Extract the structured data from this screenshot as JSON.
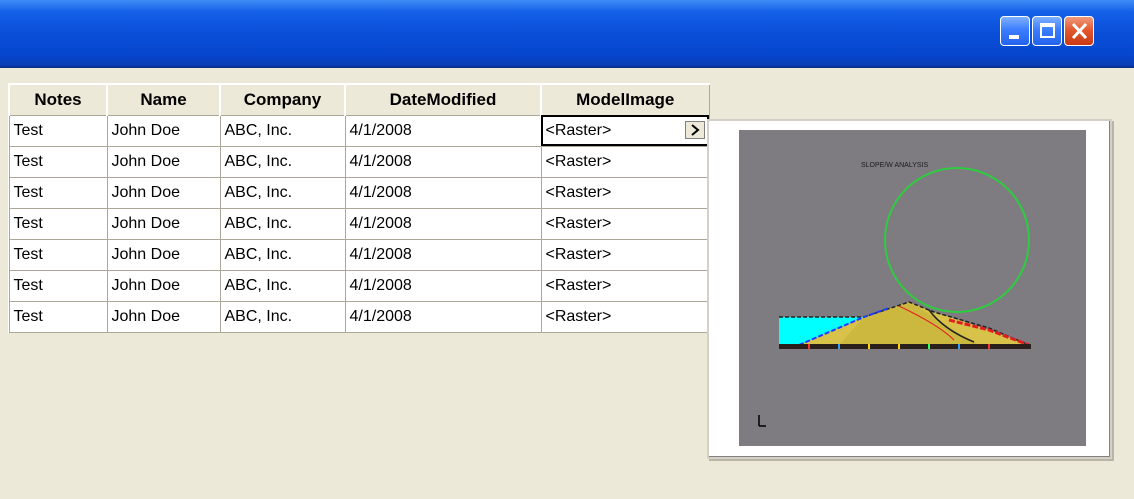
{
  "window": {
    "buttons": [
      "minimize-button",
      "maximize-button",
      "close-button"
    ],
    "accent_color": "#0a4fd9"
  },
  "grid": {
    "columns": [
      "Notes",
      "Name",
      "Company",
      "DateModified",
      "ModelImage"
    ],
    "rows": [
      [
        "Test",
        "John Doe",
        "ABC, Inc.",
        "4/1/2008",
        "<Raster>"
      ],
      [
        "Test",
        "John Doe",
        "ABC, Inc.",
        "4/1/2008",
        "<Raster>"
      ],
      [
        "Test",
        "John Doe",
        "ABC, Inc.",
        "4/1/2008",
        "<Raster>"
      ],
      [
        "Test",
        "John Doe",
        "ABC, Inc.",
        "4/1/2008",
        "<Raster>"
      ],
      [
        "Test",
        "John Doe",
        "ABC, Inc.",
        "4/1/2008",
        "<Raster>"
      ],
      [
        "Test",
        "John Doe",
        "ABC, Inc.",
        "4/1/2008",
        "<Raster>"
      ],
      [
        "Test",
        "John Doe",
        "ABC, Inc.",
        "4/1/2008",
        "<Raster>"
      ]
    ],
    "selected_cell": {
      "row": 0,
      "column": "ModelImage"
    },
    "cell_button_icon": "chevron-right-icon"
  },
  "preview": {
    "image_title": "SLOPE/W ANALYSIS",
    "background_color": "#7e7c80",
    "slip_circle_color": "#2ecc40",
    "water_color": "#00ffff"
  }
}
